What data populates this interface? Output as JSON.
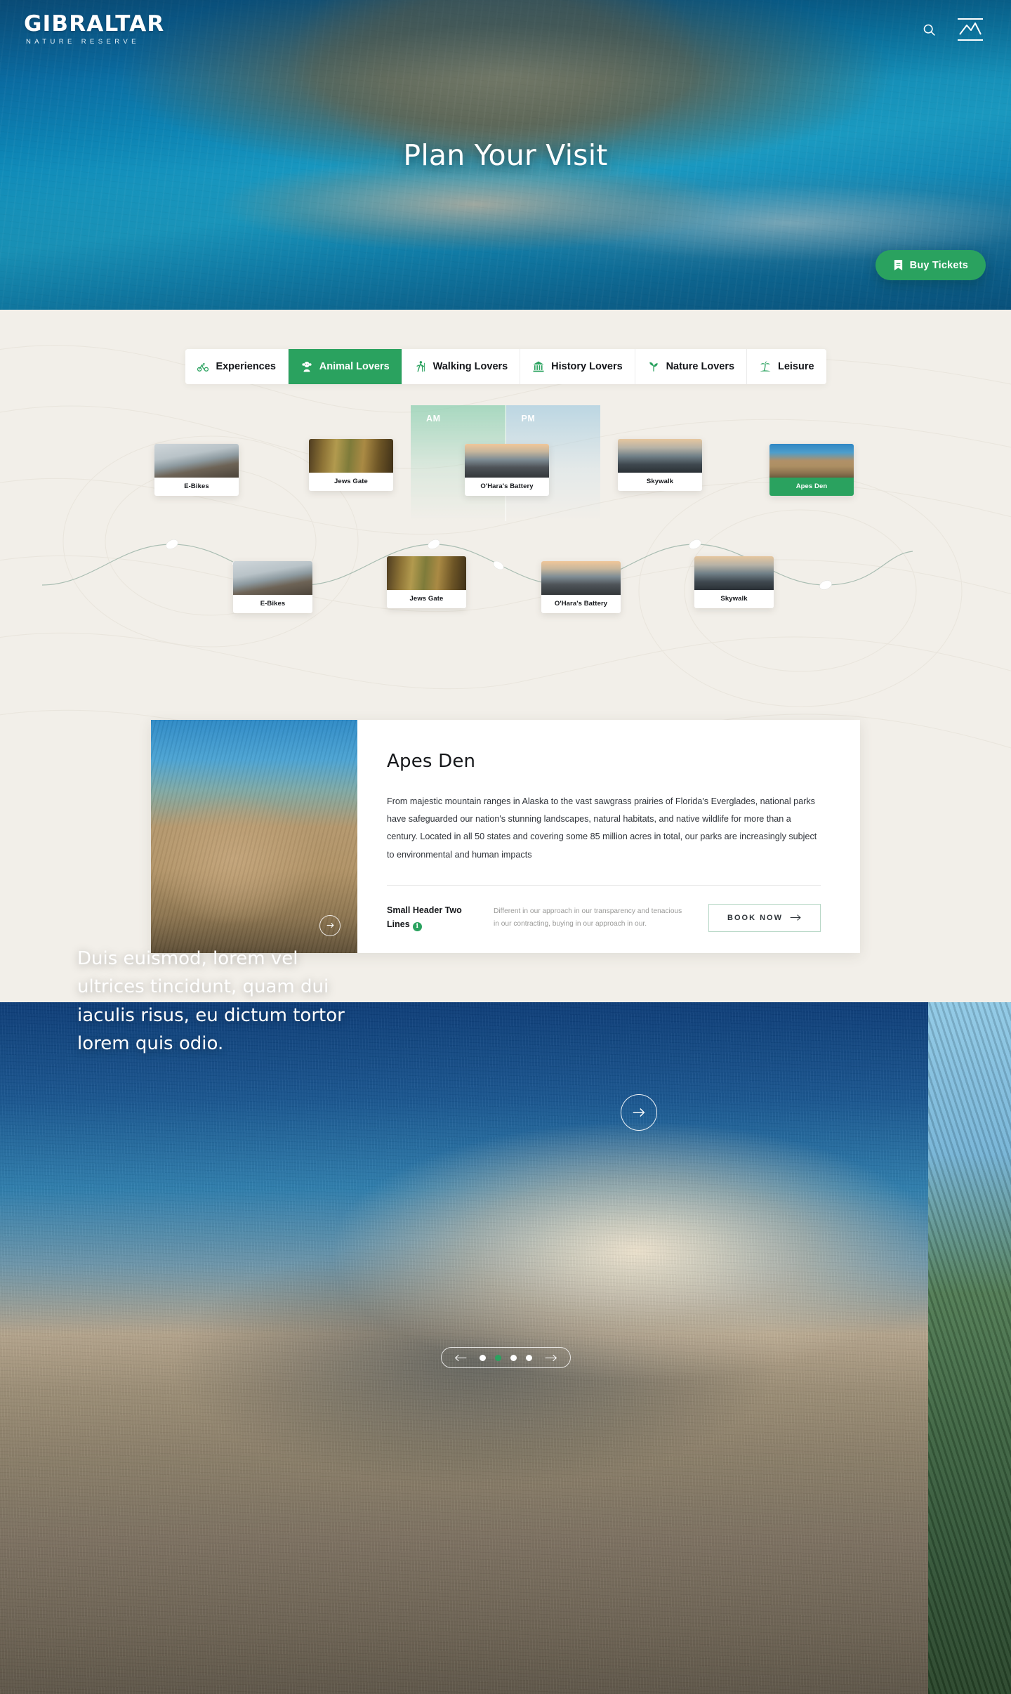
{
  "brand": {
    "name": "GIBRALTAR",
    "tagline": "NATURE RESERVE"
  },
  "header": {
    "search_icon": "search-icon",
    "menu_icon": "mountain-menu-icon"
  },
  "hero": {
    "title": "Plan Your Visit",
    "buy_tickets_label": "Buy Tickets",
    "buy_tickets_icon": "ticket-icon"
  },
  "tabs": [
    {
      "label": "Experiences",
      "icon": "bicycle-icon",
      "active": false
    },
    {
      "label": "Animal Lovers",
      "icon": "monkey-icon",
      "active": true
    },
    {
      "label": "Walking Lovers",
      "icon": "hiker-icon",
      "active": false
    },
    {
      "label": "History Lovers",
      "icon": "museum-icon",
      "active": false
    },
    {
      "label": "Nature Lovers",
      "icon": "leaf-icon",
      "active": false
    },
    {
      "label": "Leisure",
      "icon": "palm-tree-icon",
      "active": false
    }
  ],
  "timeline": {
    "am_label": "AM",
    "pm_label": "PM",
    "top_row": [
      {
        "label": "E-Bikes",
        "thumb": "cyclist-on-rocks",
        "active": false
      },
      {
        "label": "Jews Gate",
        "thumb": "cave-interior",
        "active": false
      },
      {
        "label": "O'Hara's Battery",
        "thumb": "cannon-at-sunset",
        "active": false
      },
      {
        "label": "Skywalk",
        "thumb": "city-overlook",
        "active": false
      },
      {
        "label": "Apes Den",
        "thumb": "barbary-macaques",
        "active": true
      }
    ],
    "bottom_row": [
      {
        "label": "E-Bikes",
        "thumb": "cyclist-on-rocks"
      },
      {
        "label": "Jews Gate",
        "thumb": "cave-interior"
      },
      {
        "label": "O'Hara's Battery",
        "thumb": "cannon-at-sunset"
      },
      {
        "label": "Skywalk",
        "thumb": "city-overlook"
      }
    ]
  },
  "detail": {
    "image_alt": "barbary-macaques-photo",
    "title": "Apes Den",
    "body": "From majestic mountain ranges in Alaska to the vast sawgrass prairies of Florida's Everglades, national parks have safeguarded our nation's stunning landscapes, natural habitats, and native wildlife for more than a century. Located in all 50 states and covering some 85 million acres in total, our parks are increasingly subject to environmental and human impacts",
    "small_header": "Small Header Two Lines",
    "info_icon_label": "i",
    "foot_text": "Different in our approach in our transparency and tenacious in our contracting, buying in our approach in our.",
    "book_label": "BOOK NOW"
  },
  "banner": {
    "headline": "Duis euismod, lorem vel ultrices tincidunt, quam dui iaculis risus, eu dictum tortor lorem quis odio.",
    "play_icon": "arrow-right-circle-icon",
    "carousel": {
      "prev_icon": "arrow-left-icon",
      "next_icon": "arrow-right-icon",
      "dots": 4,
      "active_index": 1
    }
  },
  "colors": {
    "accent": "#2aa25f",
    "background": "#f2efe9",
    "hero_blue": "#0d6fa6"
  }
}
